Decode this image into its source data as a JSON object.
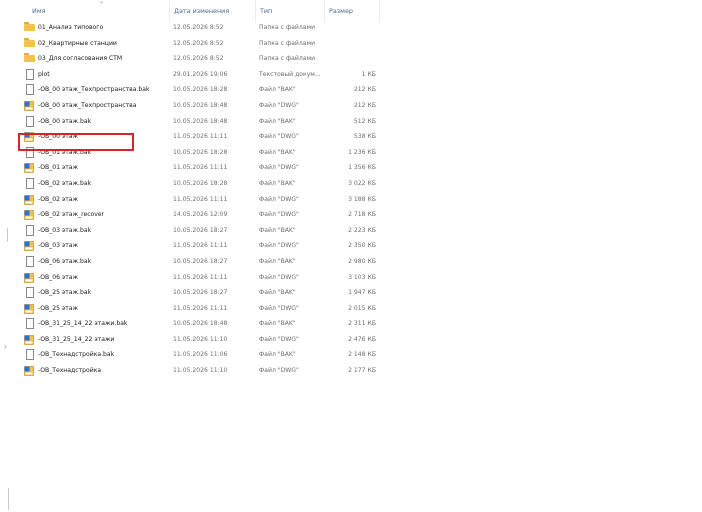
{
  "columns": {
    "name": "Имя",
    "modified": "Дата изменения",
    "type": "Тип",
    "size": "Размер"
  },
  "accent_colors": {
    "highlight_border": "#d9232a",
    "header_text": "#4d6e8f",
    "folder": "#f4c34e"
  },
  "files": [
    {
      "name": "01_Анализ типового",
      "date": "12.05.2026 8:52",
      "type": "Папка с файлами",
      "size": "",
      "icon": "folder-icon"
    },
    {
      "name": "02_Квартирные станции",
      "date": "12.05.2026 8:52",
      "type": "Папка с файлами",
      "size": "",
      "icon": "folder-icon"
    },
    {
      "name": "03_Для согласования СТМ",
      "date": "12.05.2026 8:52",
      "type": "Папка с файлами",
      "size": "",
      "icon": "folder-icon"
    },
    {
      "name": "plot",
      "date": "29.01.2026 19:06",
      "type": "Текстовый докум...",
      "size": "1 КБ",
      "icon": "document-icon"
    },
    {
      "name": "-ОВ_00 этаж_Техпространства.bak",
      "date": "10.05.2026 18:28",
      "type": "Файл \"BAK\"",
      "size": "212 КБ",
      "icon": "document-icon"
    },
    {
      "name": "-ОВ_00 этаж_Техпространства",
      "date": "10.05.2026 18:48",
      "type": "Файл \"DWG\"",
      "size": "212 КБ",
      "icon": "dwg-file-icon"
    },
    {
      "name": "-ОВ_00 этаж.bak",
      "date": "10.05.2026 18:48",
      "type": "Файл \"BAK\"",
      "size": "512 КБ",
      "icon": "document-icon"
    },
    {
      "name": "-ОВ_00 этаж",
      "date": "11.05.2026 11:11",
      "type": "Файл \"DWG\"",
      "size": "538 КБ",
      "icon": "dwg-file-icon"
    },
    {
      "name": "-ОВ_01 этаж.bak",
      "date": "10.05.2026 18:28",
      "type": "Файл \"BAK\"",
      "size": "1 236 КБ",
      "icon": "document-icon"
    },
    {
      "name": "-ОВ_01 этаж",
      "date": "11.05.2026 11:11",
      "type": "Файл \"DWG\"",
      "size": "1 356 КБ",
      "icon": "dwg-file-icon"
    },
    {
      "name": "-ОВ_02 этаж.bak",
      "date": "10.05.2026 18:28",
      "type": "Файл \"BAK\"",
      "size": "3 022 КБ",
      "icon": "document-icon"
    },
    {
      "name": "-ОВ_02 этаж",
      "date": "11.05.2026 11:11",
      "type": "Файл \"DWG\"",
      "size": "3 188 КБ",
      "icon": "dwg-file-icon"
    },
    {
      "name": "-ОВ_02 этаж_recover",
      "date": "14.05.2026 12:09",
      "type": "Файл \"DWG\"",
      "size": "2 718 КБ",
      "icon": "dwg-file-icon"
    },
    {
      "name": "-ОВ_03 этаж.bak",
      "date": "10.05.2026 18:27",
      "type": "Файл \"BAK\"",
      "size": "2 223 КБ",
      "icon": "document-icon"
    },
    {
      "name": "-ОВ_03 этаж",
      "date": "11.05.2026 11:11",
      "type": "Файл \"DWG\"",
      "size": "2 350 КБ",
      "icon": "dwg-file-icon"
    },
    {
      "name": "-ОВ_06 этаж.bak",
      "date": "10.05.2026 18:27",
      "type": "Файл \"BAK\"",
      "size": "2 980 КБ",
      "icon": "document-icon"
    },
    {
      "name": "-ОВ_06 этаж",
      "date": "11.05.2026 11:11",
      "type": "Файл \"DWG\"",
      "size": "3 103 КБ",
      "icon": "dwg-file-icon"
    },
    {
      "name": "-ОВ_25 этаж.bak",
      "date": "10.05.2026 18:27",
      "type": "Файл \"BAK\"",
      "size": "1 947 КБ",
      "icon": "document-icon"
    },
    {
      "name": "-ОВ_25 этаж",
      "date": "11.05.2026 11:11",
      "type": "Файл \"DWG\"",
      "size": "2 015 КБ",
      "icon": "dwg-file-icon"
    },
    {
      "name": "-ОВ_31_25_14_22 этажи.bak",
      "date": "10.05.2026 18:48",
      "type": "Файл \"BAK\"",
      "size": "2 311 КБ",
      "icon": "document-icon"
    },
    {
      "name": "-ОВ_31_25_14_22 этажи",
      "date": "11.05.2026 11:10",
      "type": "Файл \"DWG\"",
      "size": "2 476 КБ",
      "icon": "dwg-file-icon"
    },
    {
      "name": "-ОВ_Технадстройка.bak",
      "date": "11.05.2026 11:06",
      "type": "Файл \"BAK\"",
      "size": "2 148 КБ",
      "icon": "document-icon"
    },
    {
      "name": "-ОВ_Технадстройка",
      "date": "11.05.2026 11:10",
      "type": "Файл \"DWG\"",
      "size": "2 177 КБ",
      "icon": "dwg-file-icon"
    }
  ]
}
